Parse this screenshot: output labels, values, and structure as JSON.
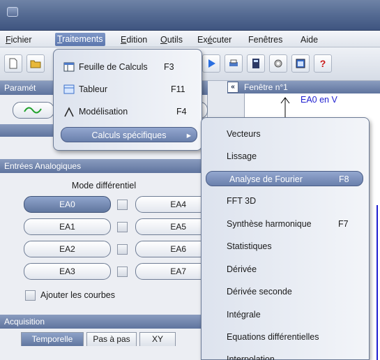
{
  "menubar": {
    "items": [
      {
        "label": "Fichier",
        "ul": "F",
        "rest": "ichier"
      },
      {
        "label": "Traitements",
        "ul": "T",
        "rest": "raitements"
      },
      {
        "label": "Edition",
        "ul": "E",
        "rest": "dition"
      },
      {
        "label": "Outils",
        "ul": "O",
        "rest": "utils"
      },
      {
        "label": "Exécuter",
        "pre": "Ex",
        "ul": "é",
        "rest": "cuter"
      },
      {
        "label": "Fenêtres",
        "ul": "",
        "rest": "Fenêtres"
      },
      {
        "label": "Aide",
        "ul": "",
        "rest": "Aide"
      }
    ]
  },
  "traitements_menu": {
    "items": [
      {
        "label": "Feuille de Calculs",
        "shortcut": "F3",
        "icon": "spreadsheet-icon"
      },
      {
        "label": "Tableur",
        "shortcut": "F11",
        "icon": "table-icon"
      },
      {
        "label": "Modélisation",
        "shortcut": "F4",
        "icon": "lambda-icon"
      },
      {
        "label": "Calculs spécifiques",
        "shortcut": "▸",
        "icon": ""
      }
    ]
  },
  "calculs_submenu": {
    "items": [
      {
        "label": "Vecteurs",
        "shortcut": ""
      },
      {
        "label": "Lissage",
        "shortcut": ""
      },
      {
        "label": "Analyse de Fourier",
        "shortcut": "F8"
      },
      {
        "label": "FFT 3D",
        "shortcut": ""
      },
      {
        "label": "Synthèse harmonique",
        "shortcut": "F7"
      },
      {
        "label": "Statistiques",
        "shortcut": ""
      },
      {
        "label": "Dérivée",
        "shortcut": ""
      },
      {
        "label": "Dérivée seconde",
        "shortcut": ""
      },
      {
        "label": "Intégrale",
        "shortcut": ""
      },
      {
        "label": "Equations différentielles",
        "shortcut": ""
      },
      {
        "label": "Interpolation",
        "shortcut": ""
      }
    ]
  },
  "left_panel": {
    "header_partial": "Paramét",
    "analog_header": "Entrées Analogiques",
    "mode_label": "Mode différentiel",
    "inputs_left": [
      "EA0",
      "EA1",
      "EA2",
      "EA3"
    ],
    "inputs_right": [
      "EA4",
      "EA5",
      "EA6",
      "EA7"
    ],
    "add_curves_label": "Ajouter les courbes",
    "acquisition_header": "Acquisition",
    "tabs": [
      "Temporelle",
      "Pas à pas",
      "XY"
    ]
  },
  "fenetre": {
    "title": "Fenêtre n°1",
    "collapse_label": "«",
    "channel_label": "EA0 en V"
  },
  "colors": {
    "accent": "#5b76ad",
    "plot_line": "#1f1fd0"
  }
}
